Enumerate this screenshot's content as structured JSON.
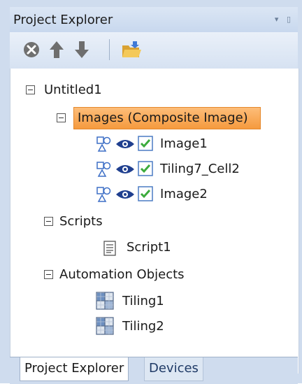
{
  "panel": {
    "title": "Project Explorer",
    "pin_glyphs": "▾ ▯"
  },
  "toolbar": {
    "buttons": [
      {
        "name": "remove-icon",
        "color": "#6e6e6e"
      },
      {
        "name": "arrow-up-icon",
        "color": "#6e6e6e"
      },
      {
        "name": "arrow-down-icon",
        "color": "#6e6e6e"
      },
      {
        "name": "open-folder-icon",
        "color": "#e9b43d"
      }
    ]
  },
  "tree": {
    "root": {
      "label": "Untitled1",
      "expanded": true
    },
    "images_group": {
      "label": "Images (Composite Image)",
      "expanded": true,
      "selected": true
    },
    "images": [
      {
        "label": "Image1",
        "visible": true,
        "checked": true
      },
      {
        "label": "Tiling7_Cell2",
        "visible": true,
        "checked": true
      },
      {
        "label": "Image2",
        "visible": true,
        "checked": true
      }
    ],
    "scripts_group": {
      "label": "Scripts",
      "expanded": true
    },
    "scripts": [
      {
        "label": "Script1"
      }
    ],
    "automation_group": {
      "label": "Automation Objects",
      "expanded": true
    },
    "automation": [
      {
        "label": "Tiling1"
      },
      {
        "label": "Tiling2"
      }
    ]
  },
  "tabs": [
    {
      "label": "Project Explorer",
      "active": true
    },
    {
      "label": "Devices",
      "active": false
    }
  ],
  "colors": {
    "selection": "#f59a3e",
    "panel_bg": "#cfdcee",
    "check_green": "#3cab3c",
    "eye_blue": "#1f3f8f"
  }
}
